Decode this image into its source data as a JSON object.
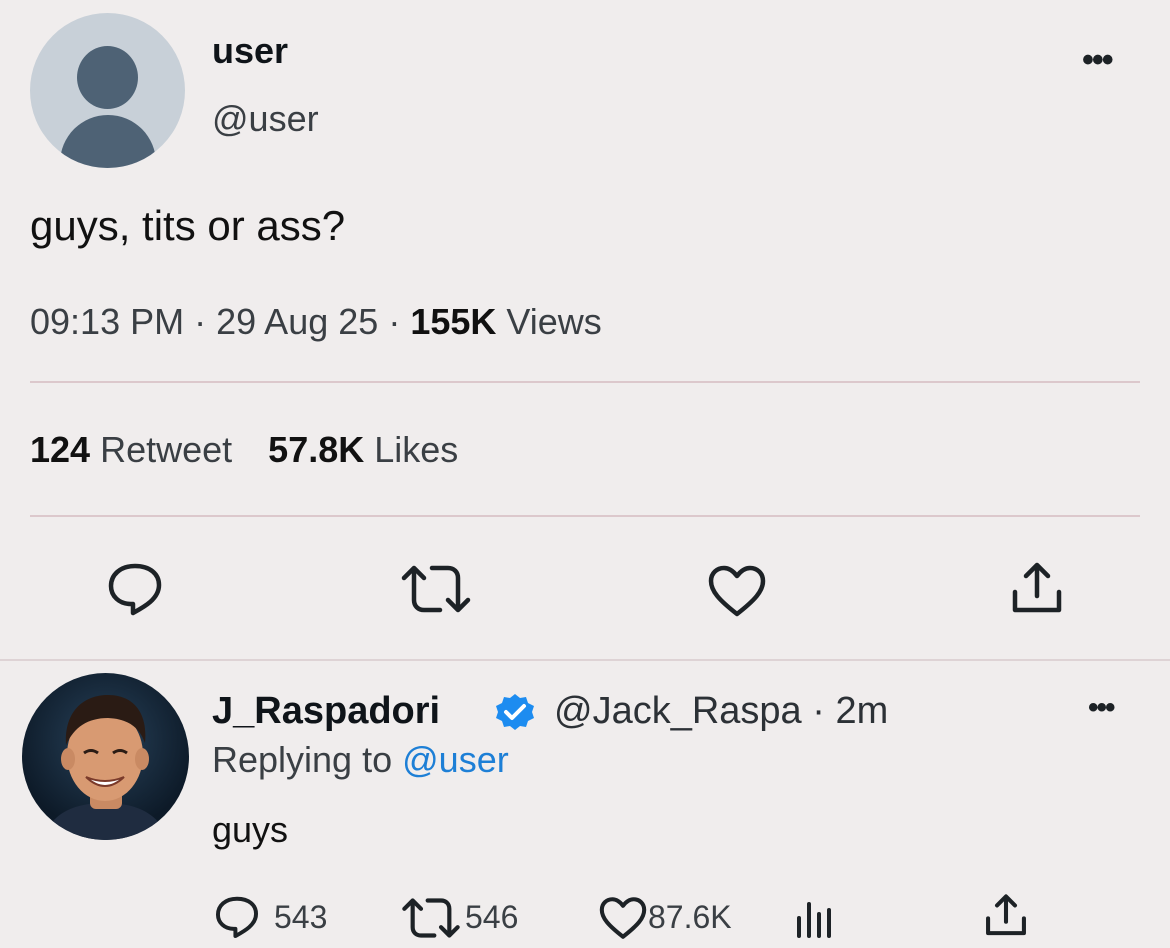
{
  "tweet": {
    "display_name": "user",
    "handle": "@user",
    "text": "guys, tits or ass?",
    "time": "09:13 PM",
    "date": "29 Aug 25",
    "views_count": "155K",
    "views_label": "Views",
    "retweet_count": "124",
    "retweet_label": "Retweet",
    "likes_count": "57.8K",
    "likes_label": "Likes",
    "more_label": "•••",
    "sep": "·"
  },
  "reply": {
    "display_name": "J_Raspadori",
    "handle": "@Jack_Raspa",
    "age": "2m",
    "replying_prefix": "Replying to",
    "replying_to": "@user",
    "text": "guys",
    "reply_count": "543",
    "retweet_count": "546",
    "like_count": "87.6K",
    "more_label": "•••",
    "sep": "·"
  },
  "colors": {
    "background": "#f0eded",
    "mention_blue": "#1d7fd6",
    "verified_blue": "#1d8cf0"
  },
  "icons": [
    "reply-icon",
    "retweet-icon",
    "like-icon",
    "share-icon",
    "views-stats-icon",
    "verified-badge-icon",
    "more-options-icon"
  ]
}
